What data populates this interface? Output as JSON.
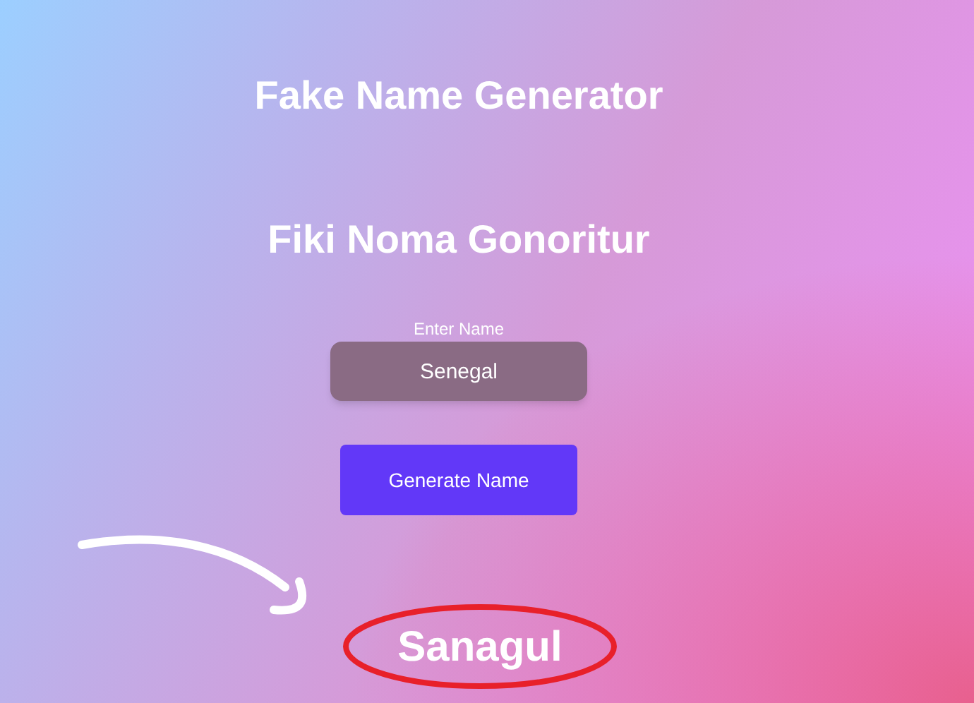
{
  "title": "Fake Name Generator",
  "subtitle": "Fiki Noma Gonoritur",
  "name_field": {
    "label": "Enter Name",
    "value": "Senegal"
  },
  "generate_button": {
    "label": "Generate Name"
  },
  "result": {
    "text": "Sanagul",
    "highlighted": true
  }
}
